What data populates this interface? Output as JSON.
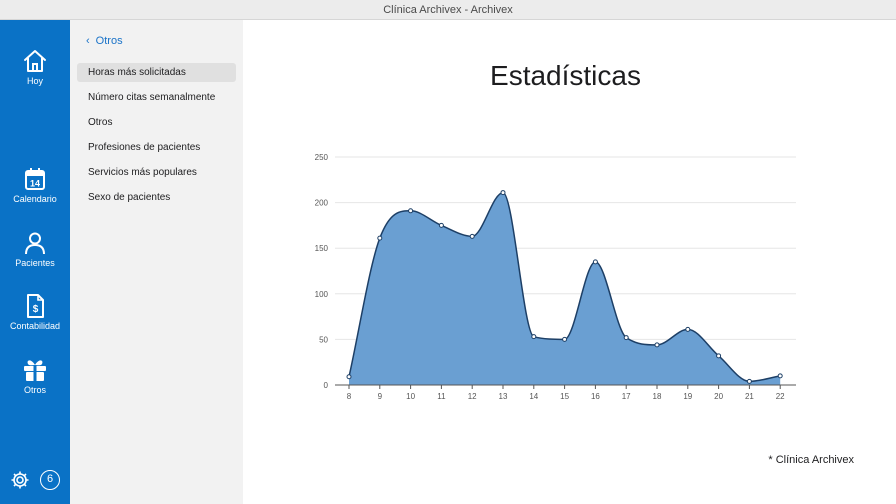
{
  "window": {
    "title": "Clínica Archivex - Archivex"
  },
  "rail": {
    "items": [
      {
        "label": "Hoy",
        "icon": "house-icon"
      },
      {
        "label": "Calendario",
        "icon": "calendar-icon",
        "day": "14"
      },
      {
        "label": "Pacientes",
        "icon": "person-icon"
      },
      {
        "label": "Contabilidad",
        "icon": "invoice-icon"
      },
      {
        "label": "Otros",
        "icon": "gift-icon"
      }
    ],
    "badge": "6"
  },
  "sidebar": {
    "back_label": "Otros",
    "items": [
      {
        "label": "Horas más solicitadas",
        "active": true
      },
      {
        "label": "Número citas semanalmente"
      },
      {
        "label": "Otros"
      },
      {
        "label": "Profesiones de pacientes"
      },
      {
        "label": "Servicios más populares"
      },
      {
        "label": "Sexo de pacientes"
      }
    ]
  },
  "main": {
    "title": "Estadísticas",
    "footer": "* Clínica Archivex"
  },
  "colors": {
    "accent": "#0a72c6",
    "fill": "#6a9fd2",
    "line": "#1d3f66"
  },
  "chart_data": {
    "type": "area",
    "x": [
      8,
      9,
      10,
      11,
      12,
      13,
      14,
      15,
      16,
      17,
      18,
      19,
      20,
      21,
      22
    ],
    "values": [
      9,
      161,
      191,
      175,
      163,
      211,
      53,
      50,
      135,
      52,
      44,
      61,
      32,
      4,
      10
    ],
    "ylim": [
      0,
      250
    ],
    "yticks": [
      0,
      50,
      100,
      150,
      200,
      250
    ],
    "grid": true,
    "xlabel": "",
    "ylabel": ""
  }
}
